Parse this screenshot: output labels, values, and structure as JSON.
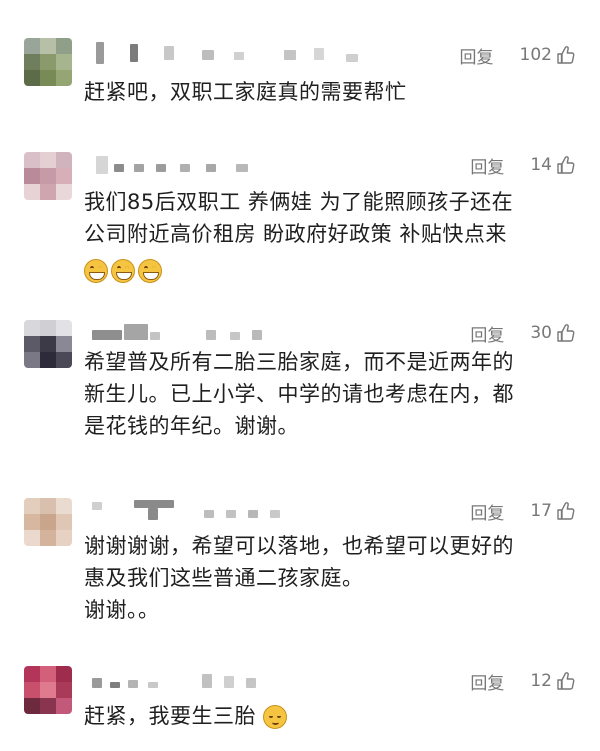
{
  "comments": [
    {
      "reply_label": "回复",
      "like_count": "102",
      "icon": "thumbs-up-icon",
      "lines": [
        "赶紧吧，双职工家庭真的需要帮忙"
      ]
    },
    {
      "reply_label": "回复",
      "like_count": "14",
      "icon": "thumbs-up-icon",
      "lines": [
        "我们85后双职工 养俩娃 为了能照顾孩子还在",
        "公司附近高价租房 盼政府好政策 补贴快点来"
      ],
      "emojis": [
        "grinning-face-icon",
        "grinning-face-icon",
        "grinning-face-icon"
      ]
    },
    {
      "reply_label": "回复",
      "like_count": "30",
      "icon": "thumbs-up-icon",
      "lines": [
        "希望普及所有二胎三胎家庭，而不是近两年的",
        "新生儿。已上小学、中学的请也考虑在内，都",
        "是花钱的年纪。谢谢。"
      ]
    },
    {
      "reply_label": "回复",
      "like_count": "17",
      "icon": "thumbs-up-icon",
      "lines": [
        "谢谢谢谢，希望可以落地，也希望可以更好的",
        "惠及我们这些普通二孩家庭。",
        "谢谢。。"
      ]
    },
    {
      "reply_label": "回复",
      "like_count": "12",
      "icon": "thumbs-up-icon",
      "lines": [
        "赶紧，我要生三胎"
      ],
      "trailing_emoji": "relieved-face-icon"
    }
  ]
}
